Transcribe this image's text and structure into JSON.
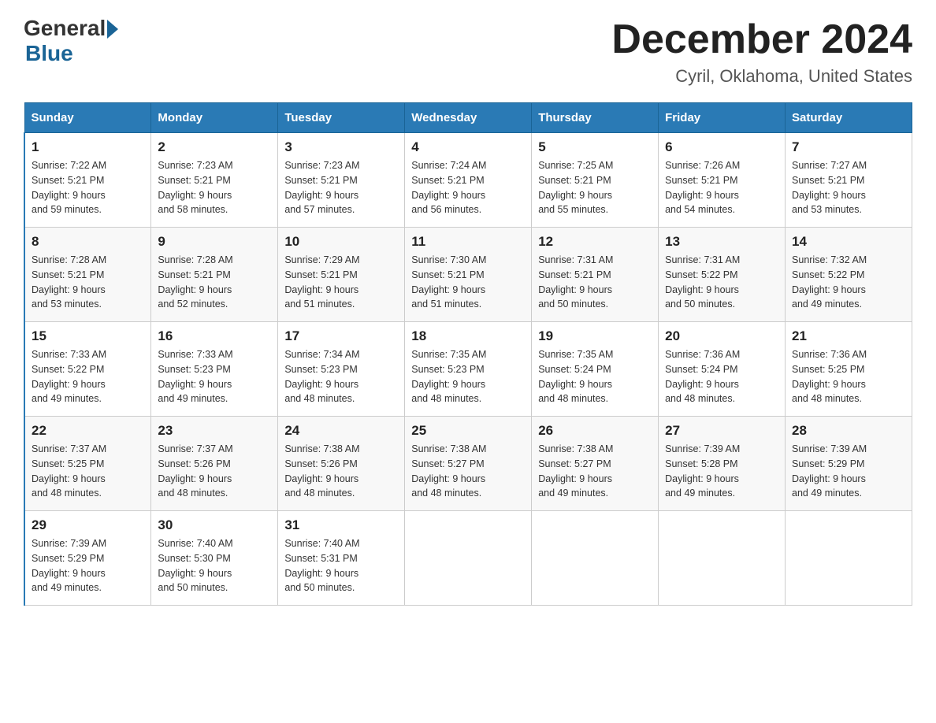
{
  "header": {
    "logo_general": "General",
    "logo_blue": "Blue",
    "month_title": "December 2024",
    "location": "Cyril, Oklahoma, United States"
  },
  "days_of_week": [
    "Sunday",
    "Monday",
    "Tuesday",
    "Wednesday",
    "Thursday",
    "Friday",
    "Saturday"
  ],
  "weeks": [
    [
      {
        "num": "1",
        "sunrise": "7:22 AM",
        "sunset": "5:21 PM",
        "daylight": "9 hours and 59 minutes."
      },
      {
        "num": "2",
        "sunrise": "7:23 AM",
        "sunset": "5:21 PM",
        "daylight": "9 hours and 58 minutes."
      },
      {
        "num": "3",
        "sunrise": "7:23 AM",
        "sunset": "5:21 PM",
        "daylight": "9 hours and 57 minutes."
      },
      {
        "num": "4",
        "sunrise": "7:24 AM",
        "sunset": "5:21 PM",
        "daylight": "9 hours and 56 minutes."
      },
      {
        "num": "5",
        "sunrise": "7:25 AM",
        "sunset": "5:21 PM",
        "daylight": "9 hours and 55 minutes."
      },
      {
        "num": "6",
        "sunrise": "7:26 AM",
        "sunset": "5:21 PM",
        "daylight": "9 hours and 54 minutes."
      },
      {
        "num": "7",
        "sunrise": "7:27 AM",
        "sunset": "5:21 PM",
        "daylight": "9 hours and 53 minutes."
      }
    ],
    [
      {
        "num": "8",
        "sunrise": "7:28 AM",
        "sunset": "5:21 PM",
        "daylight": "9 hours and 53 minutes."
      },
      {
        "num": "9",
        "sunrise": "7:28 AM",
        "sunset": "5:21 PM",
        "daylight": "9 hours and 52 minutes."
      },
      {
        "num": "10",
        "sunrise": "7:29 AM",
        "sunset": "5:21 PM",
        "daylight": "9 hours and 51 minutes."
      },
      {
        "num": "11",
        "sunrise": "7:30 AM",
        "sunset": "5:21 PM",
        "daylight": "9 hours and 51 minutes."
      },
      {
        "num": "12",
        "sunrise": "7:31 AM",
        "sunset": "5:21 PM",
        "daylight": "9 hours and 50 minutes."
      },
      {
        "num": "13",
        "sunrise": "7:31 AM",
        "sunset": "5:22 PM",
        "daylight": "9 hours and 50 minutes."
      },
      {
        "num": "14",
        "sunrise": "7:32 AM",
        "sunset": "5:22 PM",
        "daylight": "9 hours and 49 minutes."
      }
    ],
    [
      {
        "num": "15",
        "sunrise": "7:33 AM",
        "sunset": "5:22 PM",
        "daylight": "9 hours and 49 minutes."
      },
      {
        "num": "16",
        "sunrise": "7:33 AM",
        "sunset": "5:23 PM",
        "daylight": "9 hours and 49 minutes."
      },
      {
        "num": "17",
        "sunrise": "7:34 AM",
        "sunset": "5:23 PM",
        "daylight": "9 hours and 48 minutes."
      },
      {
        "num": "18",
        "sunrise": "7:35 AM",
        "sunset": "5:23 PM",
        "daylight": "9 hours and 48 minutes."
      },
      {
        "num": "19",
        "sunrise": "7:35 AM",
        "sunset": "5:24 PM",
        "daylight": "9 hours and 48 minutes."
      },
      {
        "num": "20",
        "sunrise": "7:36 AM",
        "sunset": "5:24 PM",
        "daylight": "9 hours and 48 minutes."
      },
      {
        "num": "21",
        "sunrise": "7:36 AM",
        "sunset": "5:25 PM",
        "daylight": "9 hours and 48 minutes."
      }
    ],
    [
      {
        "num": "22",
        "sunrise": "7:37 AM",
        "sunset": "5:25 PM",
        "daylight": "9 hours and 48 minutes."
      },
      {
        "num": "23",
        "sunrise": "7:37 AM",
        "sunset": "5:26 PM",
        "daylight": "9 hours and 48 minutes."
      },
      {
        "num": "24",
        "sunrise": "7:38 AM",
        "sunset": "5:26 PM",
        "daylight": "9 hours and 48 minutes."
      },
      {
        "num": "25",
        "sunrise": "7:38 AM",
        "sunset": "5:27 PM",
        "daylight": "9 hours and 48 minutes."
      },
      {
        "num": "26",
        "sunrise": "7:38 AM",
        "sunset": "5:27 PM",
        "daylight": "9 hours and 49 minutes."
      },
      {
        "num": "27",
        "sunrise": "7:39 AM",
        "sunset": "5:28 PM",
        "daylight": "9 hours and 49 minutes."
      },
      {
        "num": "28",
        "sunrise": "7:39 AM",
        "sunset": "5:29 PM",
        "daylight": "9 hours and 49 minutes."
      }
    ],
    [
      {
        "num": "29",
        "sunrise": "7:39 AM",
        "sunset": "5:29 PM",
        "daylight": "9 hours and 49 minutes."
      },
      {
        "num": "30",
        "sunrise": "7:40 AM",
        "sunset": "5:30 PM",
        "daylight": "9 hours and 50 minutes."
      },
      {
        "num": "31",
        "sunrise": "7:40 AM",
        "sunset": "5:31 PM",
        "daylight": "9 hours and 50 minutes."
      },
      null,
      null,
      null,
      null
    ]
  ],
  "labels": {
    "sunrise": "Sunrise:",
    "sunset": "Sunset:",
    "daylight": "Daylight:"
  }
}
